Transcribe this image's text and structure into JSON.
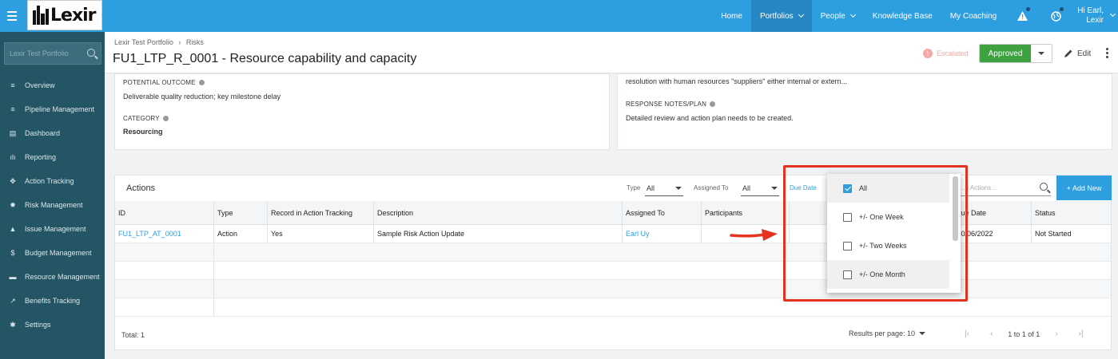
{
  "topbar": {
    "nav": [
      {
        "label": "Home",
        "active": false,
        "has_chevron": false
      },
      {
        "label": "Portfolios",
        "active": true,
        "has_chevron": true
      },
      {
        "label": "People",
        "active": false,
        "has_chevron": true
      },
      {
        "label": "Knowledge Base",
        "active": false,
        "has_chevron": false
      },
      {
        "label": "My Coaching",
        "active": false,
        "has_chevron": false
      }
    ],
    "greeting_line1": "Hi Earl,",
    "greeting_line2": "Lexir",
    "icons": [
      "menu-icon",
      "alert-icon",
      "globe-icon",
      "chevron-down-icon"
    ],
    "logo_text": "Lexir"
  },
  "sidebar": {
    "search_placeholder": "Lexir Test Portfolio",
    "items": [
      {
        "label": "Overview",
        "icon": "list-icon",
        "glyph": "≡"
      },
      {
        "label": "Pipeline Management",
        "icon": "pipeline-icon",
        "glyph": "≡"
      },
      {
        "label": "Dashboard",
        "icon": "dashboard-icon",
        "glyph": "▤"
      },
      {
        "label": "Reporting",
        "icon": "bar-chart-icon",
        "glyph": "ılı"
      },
      {
        "label": "Action Tracking",
        "icon": "move-icon",
        "glyph": "✥"
      },
      {
        "label": "Risk Management",
        "icon": "sun-icon",
        "glyph": "✹"
      },
      {
        "label": "Issue Management",
        "icon": "warning-icon",
        "glyph": "▲"
      },
      {
        "label": "Budget Management",
        "icon": "dollar-icon",
        "glyph": "$"
      },
      {
        "label": "Resource Management",
        "icon": "folder-icon",
        "glyph": "▬"
      },
      {
        "label": "Benefits Tracking",
        "icon": "line-chart-icon",
        "glyph": "↗"
      },
      {
        "label": "Settings",
        "icon": "gear-icon",
        "glyph": "✱"
      }
    ]
  },
  "header": {
    "breadcrumb_parent": "Lexir Test Portfolio",
    "breadcrumb_sep": "›",
    "breadcrumb_current": "Risks",
    "title": "FU1_LTP_R_0001 - Resource capability and capacity",
    "escalated_count": "!",
    "escalated_label": "Escalated",
    "status_button": "Approved",
    "edit_label": "Edit"
  },
  "details": {
    "left": {
      "outcome_label": "POTENTIAL OUTCOME",
      "outcome_value": "Deliverable quality reduction; key milestone delay",
      "category_label": "CATEGORY",
      "category_value": "Resourcing"
    },
    "right": {
      "truncated_text": "resolution with human resources \"suppliers\" either internal or extern...",
      "response_label": "RESPONSE NOTES/PLAN",
      "response_value": "Detailed review and action plan needs to be created."
    }
  },
  "actions": {
    "title": "Actions",
    "filters": {
      "type_label": "Type",
      "type_value": "All",
      "assigned_label": "Assigned To",
      "assigned_value": "All",
      "due_date_label": "Due Date"
    },
    "search_placeholder": "...n Actions...",
    "add_new": "+ Add New",
    "columns": [
      "ID",
      "Type",
      "Record in Action Tracking",
      "Description",
      "Assigned To",
      "Participants",
      "",
      "...ue Date",
      "Status"
    ],
    "rows": [
      {
        "id": "FU1_LTP_AT_0001",
        "type": "Action",
        "record": "Yes",
        "description": "Sample Risk Action Update",
        "assigned": "Earl Uy",
        "participants": "",
        "blank": "",
        "due": "...0/06/2022",
        "status": "Not Started"
      }
    ],
    "total": "Total: 1",
    "results_per_page": "Results per page: 10",
    "page_info": "1 to 1 of 1"
  },
  "due_dropdown": {
    "options": [
      {
        "label": "All",
        "checked": true
      },
      {
        "label": "+/- One Week",
        "checked": false
      },
      {
        "label": "+/- Two Weeks",
        "checked": false
      },
      {
        "label": "+/- One Month",
        "checked": false
      }
    ]
  },
  "colors": {
    "brand": "#2d9ee0",
    "sidebar": "#235565",
    "approved": "#3fa240",
    "highlight": "#e53322"
  }
}
